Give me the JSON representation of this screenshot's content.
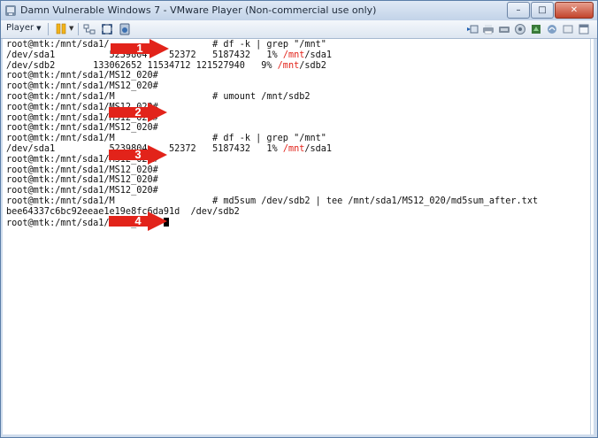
{
  "window": {
    "title": "Damn Vulnerable Windows 7 - VMware Player (Non-commercial use only)",
    "controls": {
      "minimize": "–",
      "maximize": "□",
      "close": "✕"
    }
  },
  "toolbar": {
    "player_label": "Player",
    "player_caret": "▼",
    "pause_caret": "▼",
    "left_icons": [
      "pause-icon",
      "network-icon",
      "fullscreen-icon",
      "unity-icon"
    ],
    "right_icons": [
      "send-ctrl-alt-del-icon",
      "printer-icon",
      "usb-device-icon",
      "network-adapter-icon",
      "sound-icon",
      "shared-folder-icon",
      "message-icon",
      "window-icon"
    ]
  },
  "terminal": {
    "lines": [
      [
        {
          "t": "root@mtk:/mnt/sda1/"
        },
        {
          "t": "                   "
        },
        {
          "t": "# df -k | grep \"/mnt\""
        }
      ],
      [
        {
          "t": "/dev/sda1          5239804    52372   5187432   1% "
        },
        {
          "t": "/mnt",
          "c": "red"
        },
        {
          "t": "/sda1"
        }
      ],
      [
        {
          "t": "/dev/sdb2       133062652 11534712 121527940   9% "
        },
        {
          "t": "/mnt",
          "c": "red"
        },
        {
          "t": "/sdb2"
        }
      ],
      [
        {
          "t": "root@mtk:/mnt/sda1/MS12_020#"
        }
      ],
      [
        {
          "t": "root@mtk:/mnt/sda1/MS12_020#"
        }
      ],
      [
        {
          "t": "root@mtk:/mnt/sda1/M"
        },
        {
          "t": "                  "
        },
        {
          "t": "# umount /mnt/sdb2"
        }
      ],
      [
        {
          "t": "root@mtk:/mnt/sda1/MS12_020#"
        }
      ],
      [
        {
          "t": "root@mtk:/mnt/sda1/MS12_020#"
        }
      ],
      [
        {
          "t": "root@mtk:/mnt/sda1/MS12_020#"
        }
      ],
      [
        {
          "t": "root@mtk:/mnt/sda1/M"
        },
        {
          "t": "                  "
        },
        {
          "t": "# df -k | grep \"/mnt\""
        }
      ],
      [
        {
          "t": "/dev/sda1          5239804    52372   5187432   1% "
        },
        {
          "t": "/mnt",
          "c": "red"
        },
        {
          "t": "/sda1"
        }
      ],
      [
        {
          "t": "root@mtk:/mnt/sda1/MS12_020#"
        }
      ],
      [
        {
          "t": "root@mtk:/mnt/sda1/MS12_020#"
        }
      ],
      [
        {
          "t": "root@mtk:/mnt/sda1/MS12_020#"
        }
      ],
      [
        {
          "t": "root@mtk:/mnt/sda1/MS12_020#"
        }
      ],
      [
        {
          "t": "root@mtk:/mnt/sda1/M"
        },
        {
          "t": "                  "
        },
        {
          "t": "# md5sum /dev/sdb2 | tee /mnt/sda1/MS12_020/md5sum_after.txt"
        }
      ],
      [
        {
          "t": "bee64337c6bc92eeae1e19e8fc6da91d  /dev/sdb2"
        }
      ],
      [
        {
          "t": "root@mtk:/mnt/sda1/MS12_020# "
        },
        {
          "cursor": true
        }
      ]
    ]
  },
  "annotations": {
    "arrows": [
      {
        "number": "1"
      },
      {
        "number": "2"
      },
      {
        "number": "3"
      },
      {
        "number": "4"
      }
    ]
  },
  "colors": {
    "accent_red": "#e2231a",
    "terminal_bg": "#ffffff",
    "frame": "#cfdcec"
  }
}
